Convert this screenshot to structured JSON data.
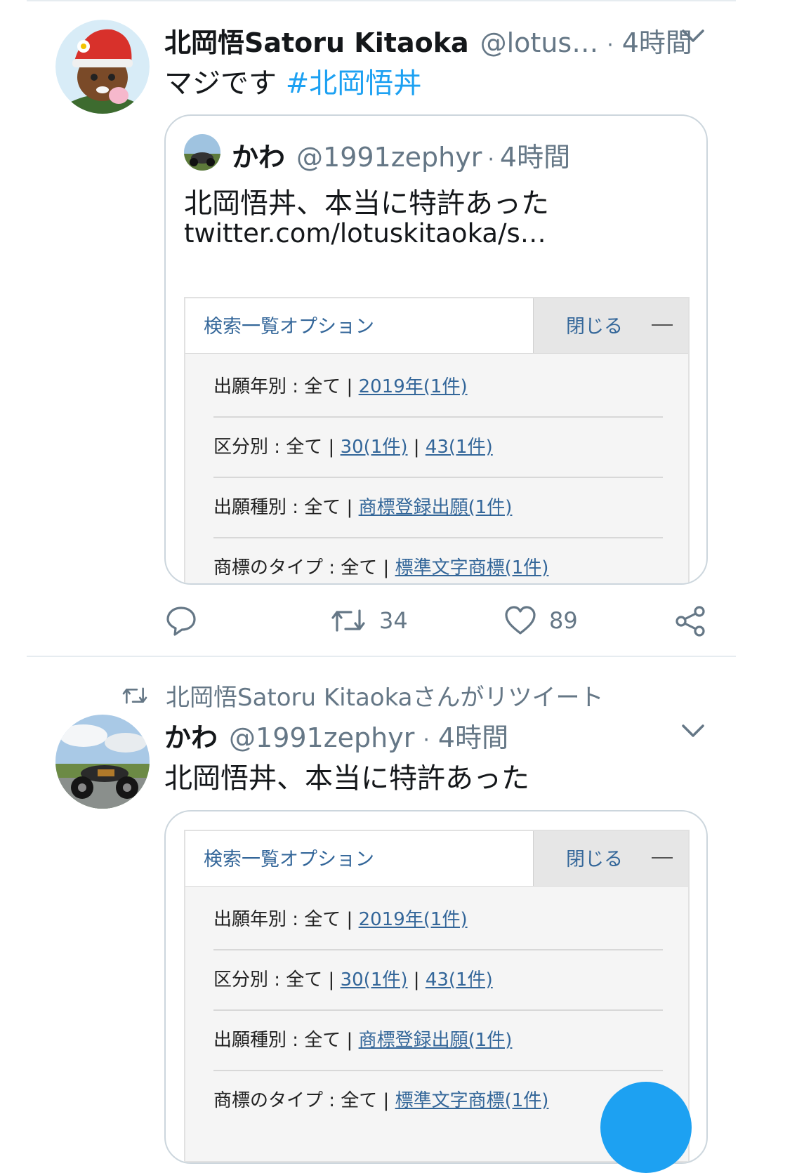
{
  "tweet1": {
    "name": "北岡悟Satoru Kitaoka",
    "handle": "@lotus…",
    "dot": "·",
    "time": "4時間",
    "text": "マジです ",
    "hashtag": "#北岡悟丼",
    "quote": {
      "name": "かわ",
      "handle": "@1991zephyr",
      "dot": "·",
      "time": "4時間",
      "text": "北岡悟丼、本当に特許あった",
      "link": "twitter.com/lotuskitaoka/s…"
    },
    "actions": {
      "retweets": "34",
      "likes": "89"
    }
  },
  "panel": {
    "title": "検索一覧オプション",
    "close": "閉じる",
    "rows": [
      {
        "label": "出願年別 : 全て | ",
        "links": [
          "2019年(1件)"
        ]
      },
      {
        "label": "区分別 : 全て | ",
        "links": [
          "30(1件)",
          "43(1件)"
        ]
      },
      {
        "label": "出願種別 : 全て | ",
        "links": [
          "商標登録出願(1件)"
        ]
      },
      {
        "label": "商標のタイプ : 全て | ",
        "links": [
          "標準文字商標(1件)"
        ]
      }
    ],
    "link_sep": " | "
  },
  "retweet_banner": "北岡悟Satoru Kitaokaさんがリツイート",
  "tweet2": {
    "name": "かわ",
    "handle": "@1991zephyr",
    "dot": "·",
    "time": "4時間",
    "text": "北岡悟丼、本当に特許あった"
  },
  "colors": {
    "accent": "#1da1f2",
    "link": "#336699",
    "muted": "#657786"
  }
}
